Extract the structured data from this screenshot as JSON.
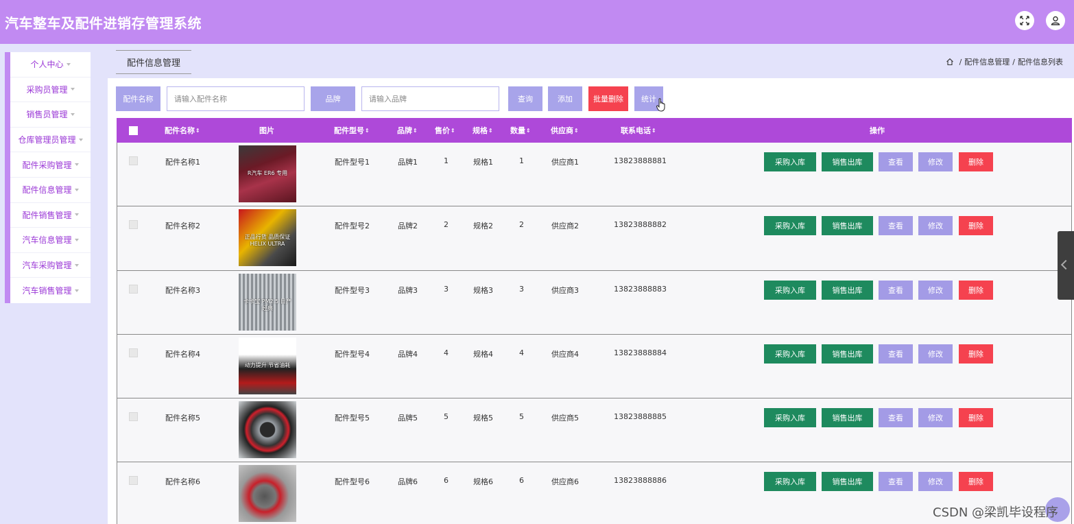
{
  "header": {
    "title": "汽车整车及配件进销存管理系统"
  },
  "sidebar": {
    "items": [
      {
        "label": "个人中心"
      },
      {
        "label": "采购员管理"
      },
      {
        "label": "销售员管理"
      },
      {
        "label": "仓库管理员管理"
      },
      {
        "label": "配件采购管理"
      },
      {
        "label": "配件信息管理"
      },
      {
        "label": "配件销售管理"
      },
      {
        "label": "汽车信息管理"
      },
      {
        "label": "汽车采购管理"
      },
      {
        "label": "汽车销售管理"
      }
    ]
  },
  "breadcrumb": {
    "tab": "配件信息管理",
    "path": [
      "配件信息管理",
      "配件信息列表"
    ],
    "separator": "/"
  },
  "search": {
    "name_label": "配件名称",
    "name_placeholder": "请输入配件名称",
    "brand_label": "品牌",
    "brand_placeholder": "请输入品牌",
    "query": "查询",
    "add": "添加",
    "batch_delete": "批量删除",
    "stats": "统计"
  },
  "table": {
    "columns": [
      "配件名称",
      "图片",
      "配件型号",
      "品牌",
      "售价",
      "规格",
      "数量",
      "供应商",
      "联系电话",
      "操作"
    ],
    "sort_icon": "⇕",
    "actions": {
      "purchase_in": "采购入库",
      "sale_out": "销售出库",
      "view": "查看",
      "edit": "修改",
      "delete": "删除"
    },
    "rows": [
      {
        "name": "配件名称1",
        "model": "配件型号1",
        "brand": "品牌1",
        "price": "1",
        "spec": "规格1",
        "qty": "1",
        "supplier": "供应商1",
        "phone": "13823888881",
        "img_text": "R汽车 ER6 专用"
      },
      {
        "name": "配件名称2",
        "model": "配件型号2",
        "brand": "品牌2",
        "price": "2",
        "spec": "规格2",
        "qty": "2",
        "supplier": "供应商2",
        "phone": "13823888882",
        "img_text": "正品行货 品质保证 HELIX ULTRA"
      },
      {
        "name": "配件名称3",
        "model": "配件型号3",
        "brand": "品牌3",
        "price": "3",
        "spec": "规格3",
        "qty": "3",
        "supplier": "供应商3",
        "phone": "13823888883",
        "img_text": "卡卡宝 PM2.5 日产 经典"
      },
      {
        "name": "配件名称4",
        "model": "配件型号4",
        "brand": "品牌4",
        "price": "4",
        "spec": "规格4",
        "qty": "4",
        "supplier": "供应商4",
        "phone": "13823888884",
        "img_text": "动力提升 节省油耗"
      },
      {
        "name": "配件名称5",
        "model": "配件型号5",
        "brand": "品牌5",
        "price": "5",
        "spec": "规格5",
        "qty": "5",
        "supplier": "供应商5",
        "phone": "13823888885",
        "img_text": ""
      },
      {
        "name": "配件名称6",
        "model": "配件型号6",
        "brand": "品牌6",
        "price": "6",
        "spec": "规格6",
        "qty": "6",
        "supplier": "供应商6",
        "phone": "13823888886",
        "img_text": ""
      }
    ]
  },
  "watermark": "CSDN @梁凯毕设程序",
  "colors": {
    "header": "#c18af2",
    "table_header": "#ae49d9",
    "label_btn": "#a8a4ea",
    "danger": "#f5424f",
    "green": "#1e8a5e",
    "lavender": "#a39be6"
  }
}
